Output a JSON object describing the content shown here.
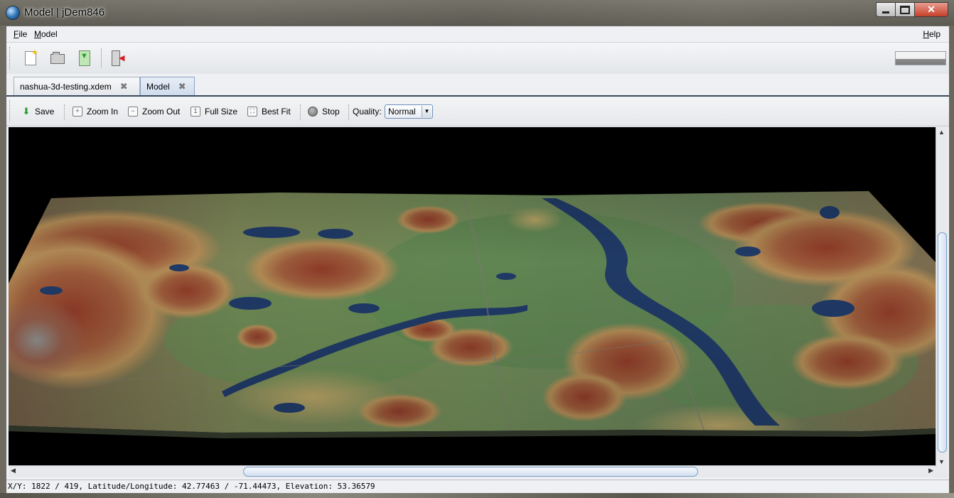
{
  "window": {
    "title": "Model | jDem846",
    "close_glyph": "✕"
  },
  "menubar": {
    "file": {
      "mnemonic": "F",
      "rest": "ile"
    },
    "model": {
      "mnemonic": "M",
      "rest": "odel"
    },
    "help": {
      "mnemonic": "H",
      "rest": "elp"
    }
  },
  "toolbar": {
    "icons": [
      "new-project-icon",
      "open-project-icon",
      "export-icon",
      "exit-icon"
    ]
  },
  "tabs": [
    {
      "label": "nashua-3d-testing.xdem",
      "active": false
    },
    {
      "label": "Model",
      "active": true
    }
  ],
  "model_toolbar": {
    "save_label": "Save",
    "zoom_in_label": "Zoom In",
    "zoom_out_label": "Zoom Out",
    "full_size_label": "Full Size",
    "best_fit_label": "Best Fit",
    "stop_label": "Stop",
    "quality_label": "Quality:",
    "quality_value": "Normal"
  },
  "status": {
    "text": "X/Y: 1822 / 419, Latitude/Longitude: 42.77463 / -71.44473, Elevation: 53.36579"
  },
  "colors": {
    "terrain_low": "#5f7d4e",
    "terrain_high": "#8a3f2a",
    "water": "#203a66",
    "viewport_bg": "#000000"
  }
}
